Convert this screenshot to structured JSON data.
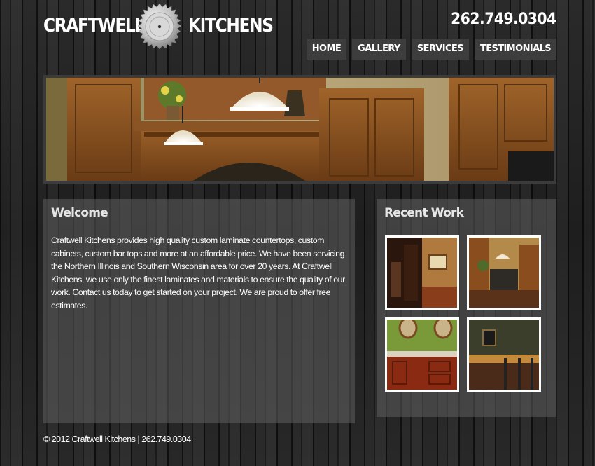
{
  "header": {
    "logo_left": "CRAFTWELL",
    "logo_right": "KITCHENS",
    "phone": "262.749.0304"
  },
  "nav": {
    "items": [
      {
        "label": "HOME"
      },
      {
        "label": "GALLERY"
      },
      {
        "label": "SERVICES"
      },
      {
        "label": "TESTIMONIALS"
      }
    ]
  },
  "welcome": {
    "title": "Welcome",
    "body": "Craftwell Kitchens provides high quality custom laminate countertops, custom cabinets, custom bar tops and more at an affordable price. We have been servicing the Northern Illinois and Southern Wisconsin area for over 20 years. At Craftwell Kitchens, we use only the finest laminates and materials to ensure the quality of our work. Contact us today to get started on your project. We are proud to offer free estimates."
  },
  "recent": {
    "title": "Recent Work"
  },
  "footer": {
    "text": "© 2012 Craftwell Kitchens | 262.749.0304"
  },
  "colors": {
    "background": "#1b1b1b",
    "panel": "#5f5f5f",
    "nav_button": "#3d3d3d",
    "wood": "#8a5424"
  }
}
